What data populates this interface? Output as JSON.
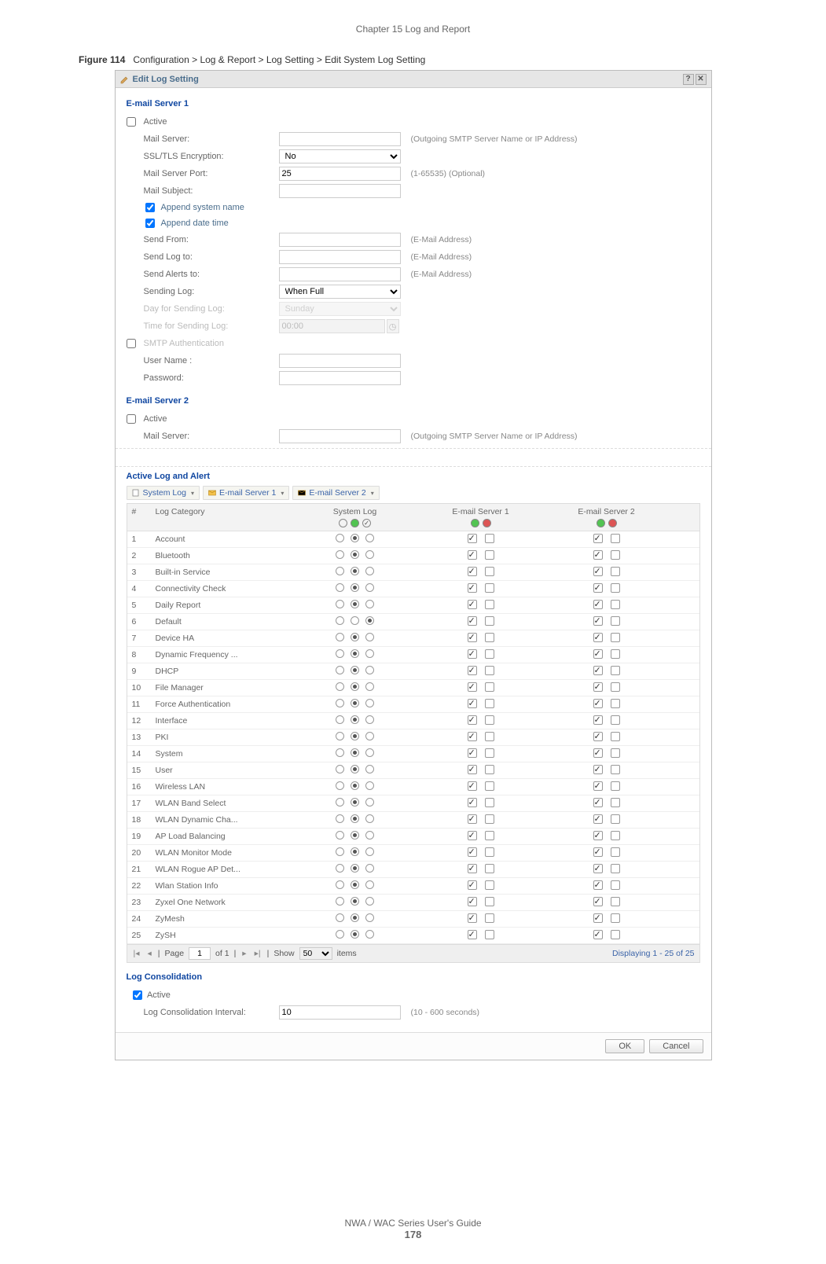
{
  "chapter_header": "Chapter 15 Log and Report",
  "figure_caption_label": "Figure 114",
  "figure_caption_text": "Configuration > Log & Report > Log Setting > Edit System Log Setting",
  "dialog": {
    "title": "Edit Log Setting",
    "section1_title": "E-mail Server 1",
    "section2_title": "E-mail Server 2",
    "active_label": "Active",
    "fields": {
      "mail_server": {
        "label": "Mail Server:",
        "value": "",
        "hint": "(Outgoing SMTP Server Name or IP Address)"
      },
      "ssl": {
        "label": "SSL/TLS Encryption:",
        "value": "No"
      },
      "port": {
        "label": "Mail Server Port:",
        "value": "25",
        "hint": "(1-65535) (Optional)"
      },
      "subject": {
        "label": "Mail Subject:",
        "value": ""
      },
      "append_name": "Append system name",
      "append_date": "Append date time",
      "send_from": {
        "label": "Send From:",
        "value": "",
        "hint": "(E-Mail Address)"
      },
      "send_log_to": {
        "label": "Send Log to:",
        "value": "",
        "hint": "(E-Mail Address)"
      },
      "send_alerts_to": {
        "label": "Send Alerts to:",
        "value": "",
        "hint": "(E-Mail Address)"
      },
      "sending_log": {
        "label": "Sending Log:",
        "value": "When Full"
      },
      "day": {
        "label": "Day for Sending Log:",
        "value": "Sunday"
      },
      "time": {
        "label": "Time for Sending Log:",
        "value": "00:00"
      },
      "smtp_auth": "SMTP Authentication",
      "user": {
        "label": "User Name :",
        "value": ""
      },
      "pass": {
        "label": "Password:",
        "value": ""
      }
    },
    "s2_fields": {
      "mail_server": {
        "label": "Mail Server:",
        "value": "",
        "hint": "(Outgoing SMTP Server Name or IP Address)"
      }
    },
    "active_log_title": "Active Log and Alert",
    "tabs": {
      "system_log": "System Log",
      "email1": "E-mail Server 1",
      "email2": "E-mail Server 2"
    },
    "table_headers": {
      "num": "#",
      "category": "Log Category",
      "syslog": "System Log",
      "email1": "E-mail Server 1",
      "email2": "E-mail Server 2"
    },
    "log_rows": [
      {
        "n": "1",
        "cat": "Account",
        "s": 1
      },
      {
        "n": "2",
        "cat": "Bluetooth",
        "s": 1
      },
      {
        "n": "3",
        "cat": "Built-in Service",
        "s": 1
      },
      {
        "n": "4",
        "cat": "Connectivity Check",
        "s": 1
      },
      {
        "n": "5",
        "cat": "Daily Report",
        "s": 1
      },
      {
        "n": "6",
        "cat": "Default",
        "s": 2
      },
      {
        "n": "7",
        "cat": "Device HA",
        "s": 1
      },
      {
        "n": "8",
        "cat": "Dynamic Frequency ...",
        "s": 1
      },
      {
        "n": "9",
        "cat": "DHCP",
        "s": 1
      },
      {
        "n": "10",
        "cat": "File Manager",
        "s": 1
      },
      {
        "n": "11",
        "cat": "Force Authentication",
        "s": 1
      },
      {
        "n": "12",
        "cat": "Interface",
        "s": 1
      },
      {
        "n": "13",
        "cat": "PKI",
        "s": 1
      },
      {
        "n": "14",
        "cat": "System",
        "s": 1
      },
      {
        "n": "15",
        "cat": "User",
        "s": 1
      },
      {
        "n": "16",
        "cat": "Wireless LAN",
        "s": 1
      },
      {
        "n": "17",
        "cat": "WLAN Band Select",
        "s": 1
      },
      {
        "n": "18",
        "cat": "WLAN Dynamic Cha...",
        "s": 1
      },
      {
        "n": "19",
        "cat": "AP Load Balancing",
        "s": 1
      },
      {
        "n": "20",
        "cat": "WLAN Monitor Mode",
        "s": 1
      },
      {
        "n": "21",
        "cat": "WLAN Rogue AP Det...",
        "s": 1
      },
      {
        "n": "22",
        "cat": "Wlan Station Info",
        "s": 1
      },
      {
        "n": "23",
        "cat": "Zyxel One Network",
        "s": 1
      },
      {
        "n": "24",
        "cat": "ZyMesh",
        "s": 1
      },
      {
        "n": "25",
        "cat": "ZySH",
        "s": 1
      }
    ],
    "pager": {
      "page_label": "Page",
      "page": "1",
      "of_label": "of 1",
      "show_label": "Show",
      "show": "50",
      "items_label": "items",
      "display": "Displaying 1 - 25 of 25"
    },
    "consolidation_title": "Log Consolidation",
    "consolidation": {
      "active": "Active",
      "interval_label": "Log Consolidation Interval:",
      "interval": "10",
      "interval_hint": "(10 - 600 seconds)"
    },
    "buttons": {
      "ok": "OK",
      "cancel": "Cancel"
    }
  },
  "footer": {
    "guide": "NWA / WAC Series User's Guide",
    "page": "178"
  }
}
